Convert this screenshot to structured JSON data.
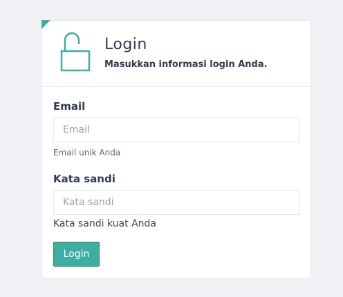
{
  "header": {
    "title": "Login",
    "subtitle": "Masukkan informasi login Anda.",
    "icon": "unlocked-padlock-icon"
  },
  "form": {
    "email": {
      "label": "Email",
      "placeholder": "Email",
      "value": "",
      "help": "Email unik Anda"
    },
    "password": {
      "label": "Kata sandi",
      "placeholder": "Kata sandi",
      "value": "",
      "help": "Kata sandi kuat Anda"
    },
    "submit_label": "Login"
  },
  "colors": {
    "accent": "#3eada3",
    "button_border": "#2e8f2a",
    "text": "#2f3b4e",
    "background": "#f0f2f6"
  }
}
